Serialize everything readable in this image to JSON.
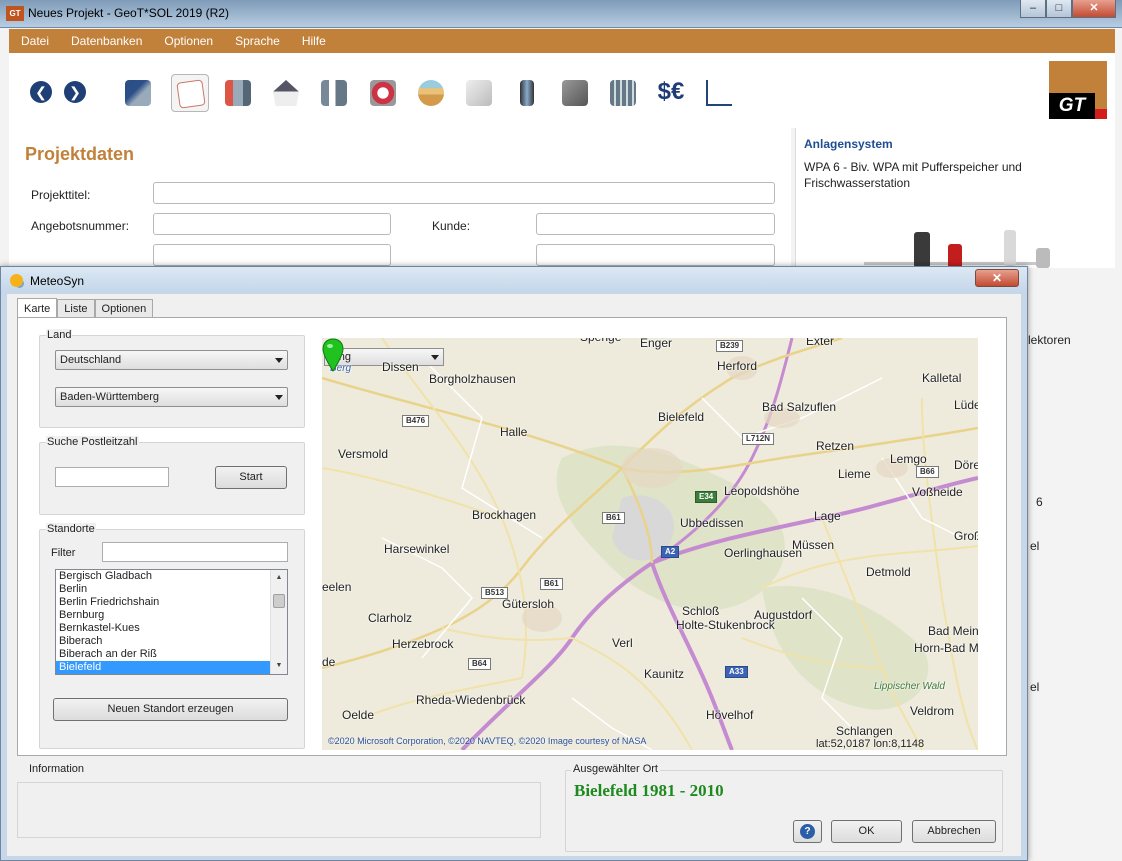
{
  "main_window": {
    "title": "Neues Projekt - GeoT*SOL 2019 (R2)",
    "menu": [
      "Datei",
      "Datenbanken",
      "Optionen",
      "Sprache",
      "Hilfe"
    ],
    "logo_text": "GT"
  },
  "project": {
    "heading": "Projektdaten",
    "projekttitel_label": "Projekttitel:",
    "angebotsnummer_label": "Angebotsnummer:",
    "kunde_label": "Kunde:"
  },
  "anlagensystem": {
    "title": "Anlagensystem",
    "description": "WPA 6 - Biv. WPA mit Pufferspeicher und Frischwasserstation",
    "side_fragments": [
      "lektoren",
      "6",
      "el",
      "el"
    ]
  },
  "dialog": {
    "title": "MeteoSyn",
    "close_label": "✕",
    "tabs": [
      "Karte",
      "Liste",
      "Optionen"
    ],
    "land": {
      "label": "Land",
      "country": "Deutschland",
      "state": "Baden-Württemberg"
    },
    "postleitzahl": {
      "label": "Suche Postleitzahl",
      "value": "",
      "button": "Start"
    },
    "standorte": {
      "label": "Standorte",
      "filter_label": "Filter",
      "filter_value": "",
      "items": [
        "Bergisch Gladbach",
        "Berlin",
        "Berlin Friedrichshain",
        "Bernburg",
        "Bernkastel-Kues",
        "Biberach",
        "Biberach an der Riß",
        "Bielefeld"
      ],
      "selected": "Bielefeld",
      "new_button": "Neuen Standort erzeugen"
    },
    "map": {
      "provider": "Bing",
      "copyright": "©2020 Microsoft Corporation, ©2020 NAVTEQ, ©2020 Image courtesy of NASA",
      "coords": "lat:52,0187  lon:8,1148",
      "labels": [
        "Spenge",
        "Enger",
        "Exter",
        "Berg",
        "Dissen",
        "Borgholzhausen",
        "Herford",
        "Kalletal",
        "Bielefeld",
        "Bad Salzuflen",
        "Lüde",
        "Halle",
        "Versmold",
        "Retzen",
        "Lemgo",
        "Dörе",
        "Liеme",
        "Leopoldshöhe",
        "Voßheide",
        "Brockhagen",
        "Lage",
        "Ubbedissen",
        "Harsewinkel",
        "Oerlinghausen",
        "Müssen",
        "Groß",
        "Detmold",
        "eelen",
        "Gütersloh",
        "Schloß",
        "Holte-Stukenbrock",
        "Augustdorf",
        "Clarholz",
        "Herzebrock",
        "Verl",
        "Bad Mein",
        "Horn-Bad Meinberg",
        "Kaunitz",
        "Lippischer Wald",
        "Rheda-Wiedenbrück",
        "Oelde",
        "Hövelhof",
        "Veldrom",
        "Schlangen",
        "de"
      ],
      "road_shields": [
        "B239",
        "B476",
        "L712N",
        "B66",
        "E34",
        "B61",
        "A2",
        "B61",
        "B513",
        "B64",
        "A33"
      ]
    },
    "information_label": "Information",
    "information_text": "",
    "ort_label": "Ausgewählter Ort",
    "ort_value": "Bielefeld 1981 - 2010",
    "help_label": "?",
    "ok_label": "OK",
    "cancel_label": "Abbrechen"
  }
}
